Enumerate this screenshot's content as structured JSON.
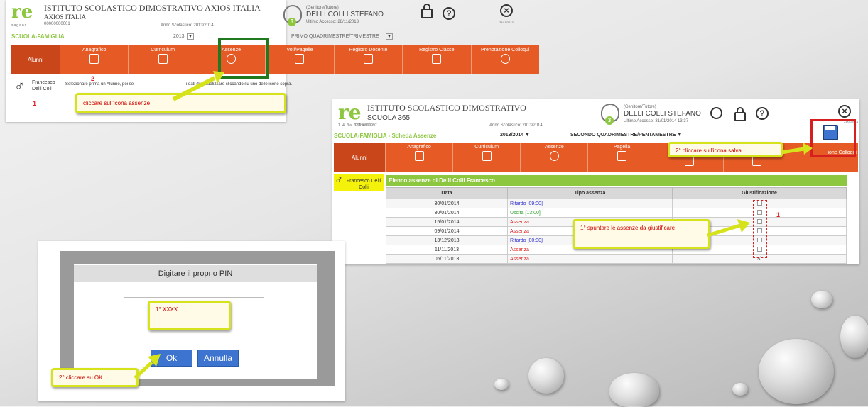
{
  "panel1": {
    "logo": "re",
    "logo_sub": "sagaos",
    "school_line1": "ISTITUTO SCOLASTICO DIMOSTRATIVO AXIOS ITALIA",
    "school_line2": "AXIOS ITALIA",
    "code": "00000000001",
    "anno": "Anno Scolastico: 2013/2014",
    "role": "(Genitore/Tutore)",
    "user": "DELLI COLLI STEFANO",
    "last_access": "Ultimo Accesso: 28/11/2013",
    "user_num": "3",
    "date_small": "28/11/2013",
    "section": "SCUOLA-FAMIGLIA",
    "year": "2013",
    "period": "PRIMO QUADRIMESTRE/TRIMESTRE",
    "alunni": "Alunni",
    "menu": [
      "Anagrafico",
      "Curriculum",
      "Assenze",
      "Voti/Pagelle",
      "Registro Docente",
      "Registro Classe",
      "Prenotazione Colloqui"
    ],
    "student": "Francesco Delli Coll",
    "step_2": "2",
    "step_1": "1",
    "instruction": "Selezionare prima un Alunno, poi sel",
    "instruction_end": "i dati da visualizzare cliccando su uno delle icone sopra.",
    "callout": "cliccare sull'icona assenze"
  },
  "panel2": {
    "logo": "re",
    "logo_sub": "1.4.3a.6.3.4a",
    "code": "99999999997",
    "school_line1": "ISTITUTO SCOLASTICO DIMOSTRATIVO",
    "school_line2": "SCUOLA 365",
    "anno": "Anno Scolastico: 2013/2014",
    "role": "(Genitore/Tutore)",
    "user": "DELLI COLLI STEFANO",
    "last_access": "Ultimo Accesso: 31/01/2014 13:37",
    "user_num": "3",
    "date_small": "31/01/2014",
    "section": "SCUOLA-FAMIGLIA - Scheda Assenze",
    "year": "2013/2014 ▼",
    "period": "SECONDO QUADRIMESTRE/PENTAMESTRE ▼",
    "alunni": "Alunni",
    "menu": [
      "Anagrafico",
      "Curriculum",
      "Assenze",
      "Pagella"
    ],
    "menu_partial": "ione Colloqui",
    "student": "Francesco Delli Colli",
    "table_title": "Elenco assenze di Delli Colli Francesco",
    "cols": [
      "Data",
      "Tipo assenza",
      "Giustificazione"
    ],
    "rows": [
      {
        "date": "30/01/2014",
        "type": "Ritardo [09:00]",
        "just": ""
      },
      {
        "date": "30/01/2014",
        "type": "Uscita [13:00]",
        "just": ""
      },
      {
        "date": "15/01/2014",
        "type": "Assenza",
        "just": ""
      },
      {
        "date": "09/01/2014",
        "type": "Assenza",
        "just": ""
      },
      {
        "date": "13/12/2013",
        "type": "Ritardo [00:00]",
        "just": ""
      },
      {
        "date": "11/11/2013",
        "type": "Assenza",
        "just": ""
      },
      {
        "date": "05/11/2013",
        "type": "Assenza",
        "just": "Sì"
      }
    ],
    "step_1": "1",
    "callout_save": "2° cliccare sull'icona salva",
    "callout_check": "1° spuntare le assenze da giustificare"
  },
  "panel3": {
    "title": "Digitare il proprio PIN",
    "callout_pin": "1° XXXX",
    "ok": "Ok",
    "cancel": "Annulla",
    "callout_ok": "2° cliccare su OK"
  },
  "colors": {
    "menu": "#e65a26",
    "green": "#8dc63f",
    "callout_border": "#d6e31b",
    "highlight_green": "#1f7a1f",
    "highlight_red": "#d62020"
  }
}
